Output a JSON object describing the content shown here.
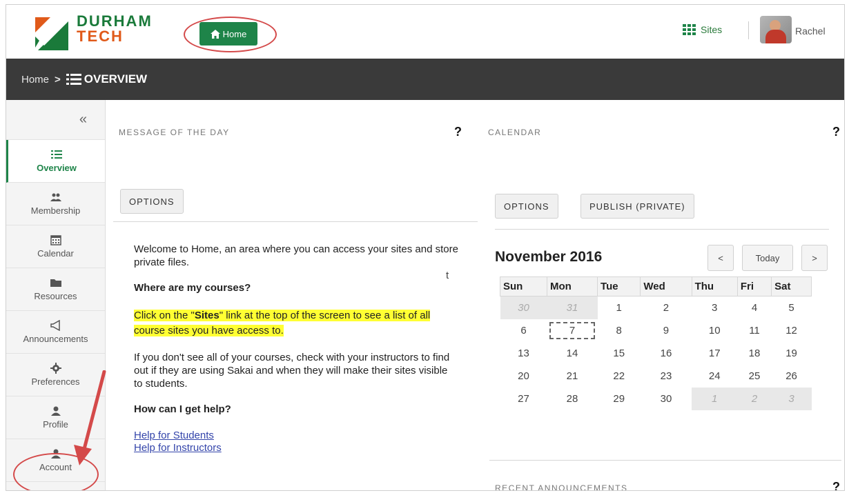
{
  "header": {
    "logo_line1": "DURHAM",
    "logo_line2": "TECH",
    "home_button": "Home",
    "sites_label": "Sites",
    "user_name": "Rachel"
  },
  "breadcrumb": {
    "home": "Home",
    "separator": ">",
    "current": "OVERVIEW"
  },
  "sidebar": {
    "collapse_label": "«",
    "items": [
      {
        "label": "Overview",
        "icon": "list-icon"
      },
      {
        "label": "Membership",
        "icon": "users-icon"
      },
      {
        "label": "Calendar",
        "icon": "calendar-icon"
      },
      {
        "label": "Resources",
        "icon": "folder-icon"
      },
      {
        "label": "Announcements",
        "icon": "megaphone-icon"
      },
      {
        "label": "Preferences",
        "icon": "gear-icon"
      },
      {
        "label": "Profile",
        "icon": "user-icon"
      },
      {
        "label": "Account",
        "icon": "user-icon"
      }
    ]
  },
  "motd": {
    "title": "MESSAGE OF THE DAY",
    "help": "?",
    "options_button": "OPTIONS",
    "intro": "Welcome to Home, an area where you can access your sites and store private files.",
    "stray_char": "t",
    "q1": "Where are my courses?",
    "hl_prefix": "Click on the \"",
    "hl_bold": "Sites",
    "hl_suffix": "\" link at the top of the screen to see a list of all course sites you have access to.",
    "p2": "If you don't see all of your courses, check with your instructors to find out if they are using Sakai and when they will make their sites visible to students.",
    "q2": "How can I get help?",
    "link1": "Help for Students",
    "link2": "Help for Instructors"
  },
  "calendar": {
    "title": "CALENDAR",
    "help": "?",
    "options_button": "OPTIONS",
    "publish_button": "PUBLISH (PRIVATE)",
    "month": "November 2016",
    "prev": "<",
    "today": "Today",
    "next": ">",
    "days": [
      "Sun",
      "Mon",
      "Tue",
      "Wed",
      "Thu",
      "Fri",
      "Sat"
    ],
    "weeks": [
      [
        "30",
        "31",
        "1",
        "2",
        "3",
        "4",
        "5"
      ],
      [
        "6",
        "7",
        "8",
        "9",
        "10",
        "11",
        "12"
      ],
      [
        "13",
        "14",
        "15",
        "16",
        "17",
        "18",
        "19"
      ],
      [
        "20",
        "21",
        "22",
        "23",
        "24",
        "25",
        "26"
      ],
      [
        "27",
        "28",
        "29",
        "30",
        "1",
        "2",
        "3"
      ]
    ]
  },
  "announcements": {
    "title": "RECENT ANNOUNCEMENTS",
    "help": "?"
  },
  "colors": {
    "brand_green": "#1e8449",
    "brand_orange": "#e05a1a",
    "annotation_red": "#d44a4a",
    "highlight_yellow": "#ffff33"
  }
}
